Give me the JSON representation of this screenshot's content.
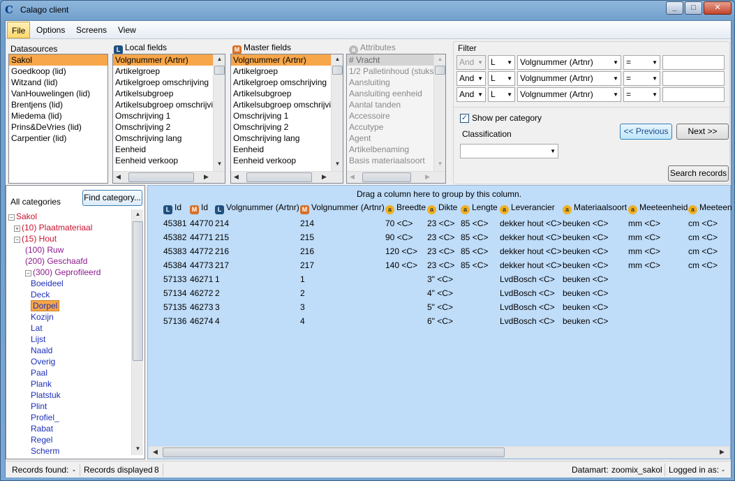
{
  "window": {
    "title": "Calago client"
  },
  "menu": [
    "File",
    "Options",
    "Screens",
    "View"
  ],
  "datasources": {
    "label": "Datasources",
    "items": [
      "Sakol",
      "Goedkoop (lid)",
      "Witzand (lid)",
      "VanHouwelingen (lid)",
      "Brentjens (lid)",
      "Miedema (lid)",
      "Prins&DeVries (lid)",
      "Carpentier (lid)"
    ]
  },
  "local_fields": {
    "badge": "L",
    "label": "Local fields",
    "items": [
      "Volgnummer (Artnr)",
      "Artikelgroep",
      "Artikelgroep omschrijving",
      "Artikelsubgroep",
      "Artikelsubgroep omschrijvin",
      "Omschrijving 1",
      "Omschrijving 2",
      "Omschrijving lang",
      "Eenheid",
      "Eenheid verkoop"
    ]
  },
  "master_fields": {
    "badge": "M",
    "label": "Master fields",
    "items": [
      "Volgnummer (Artnr)",
      "Artikelgroep",
      "Artikelgroep omschrijving",
      "Artikelsubgroep",
      "Artikelsubgroep omschrijvin",
      "Omschrijving 1",
      "Omschrijving 2",
      "Omschrijving lang",
      "Eenheid",
      "Eenheid verkoop"
    ]
  },
  "attributes": {
    "badge": "a",
    "label": "Attributes",
    "items": [
      "# Vracht",
      "1/2 Palletinhoud (stuks)",
      "Aansluiting",
      "Aansluiting eenheid",
      "Aantal tanden",
      "Accessoire",
      "Accutype",
      "Agent",
      "Artikelbenaming",
      "Basis materiaalsoort"
    ]
  },
  "filter": {
    "label": "Filter",
    "rows": [
      {
        "logic": "And",
        "disabled": true,
        "type": "L",
        "field": "Volgnummer (Artnr)",
        "op": "="
      },
      {
        "logic": "And",
        "disabled": false,
        "type": "L",
        "field": "Volgnummer (Artnr)",
        "op": "="
      },
      {
        "logic": "And",
        "disabled": false,
        "type": "L",
        "field": "Volgnummer (Artnr)",
        "op": "="
      }
    ],
    "show_per_category": "Show per category",
    "show_per_category_checked": "✓",
    "classification_label": "Classification",
    "prev_label": "<< Previous",
    "next_label": "Next >>",
    "search_label": "Search records"
  },
  "categories": {
    "title": "All categories",
    "find_label": "Find category...",
    "tree": [
      {
        "text": "Sakol",
        "pm": "−",
        "color": "#c8102e"
      },
      {
        "text": "(10) Plaatmateriaal",
        "pm": "+",
        "color": "#c8102e"
      },
      {
        "text": "(15) Hout",
        "pm": "−",
        "color": "#c8102e"
      },
      {
        "text": "(100) Ruw",
        "pm": "",
        "color": "#8e1a8e"
      },
      {
        "text": "(200) Geschaafd",
        "pm": "",
        "color": "#8e1a8e"
      },
      {
        "text": "(300) Geprofileerd",
        "pm": "−",
        "color": "#8e1a8e"
      },
      {
        "text": "Boeideel",
        "pm": "",
        "color": "#1c2fb8"
      },
      {
        "text": "Deck",
        "pm": "",
        "color": "#1c2fb8"
      },
      {
        "text": "Dorpel",
        "pm": "",
        "color": "#1c2fb8",
        "selected": true
      },
      {
        "text": "Kozijn",
        "pm": "",
        "color": "#1c2fb8"
      },
      {
        "text": "Lat",
        "pm": "",
        "color": "#1c2fb8"
      },
      {
        "text": "Lijst",
        "pm": "",
        "color": "#1c2fb8"
      },
      {
        "text": "Naald",
        "pm": "",
        "color": "#1c2fb8"
      },
      {
        "text": "Overig",
        "pm": "",
        "color": "#1c2fb8"
      },
      {
        "text": "Paal",
        "pm": "",
        "color": "#1c2fb8"
      },
      {
        "text": "Plank",
        "pm": "",
        "color": "#1c2fb8"
      },
      {
        "text": "Platstuk",
        "pm": "",
        "color": "#1c2fb8"
      },
      {
        "text": "Plint",
        "pm": "",
        "color": "#1c2fb8"
      },
      {
        "text": "Profiel_",
        "pm": "",
        "color": "#1c2fb8"
      },
      {
        "text": "Rabat",
        "pm": "",
        "color": "#1c2fb8"
      },
      {
        "text": "Regel",
        "pm": "",
        "color": "#1c2fb8"
      },
      {
        "text": "Scherm",
        "pm": "",
        "color": "#1c2fb8"
      }
    ]
  },
  "grid": {
    "group_hint": "Drag a column here to group by this column.",
    "columns": [
      {
        "badge": "L",
        "label": "Id"
      },
      {
        "badge": "M",
        "label": "Id"
      },
      {
        "badge": "L",
        "label": "Volgnummer (Artnr)"
      },
      {
        "badge": "M",
        "label": "Volgnummer (Artnr)"
      },
      {
        "badge": "a",
        "label": "Breedte"
      },
      {
        "badge": "a",
        "label": "Dikte"
      },
      {
        "badge": "a",
        "label": "Lengte"
      },
      {
        "badge": "a",
        "label": "Leverancier"
      },
      {
        "badge": "a",
        "label": "Materiaalsoort"
      },
      {
        "badge": "a",
        "label": "Meeteenheid"
      },
      {
        "badge": "a",
        "label": "Meeteen"
      }
    ],
    "rows": [
      [
        "45381",
        "44770",
        "214",
        "214",
        "70 <C>",
        "23 <C>",
        "85 <C>",
        "dekker hout <C>",
        "beuken <C>",
        "mm <C>",
        "cm <C>"
      ],
      [
        "45382",
        "44771",
        "215",
        "215",
        "90 <C>",
        "23 <C>",
        "85 <C>",
        "dekker hout <C>",
        "beuken <C>",
        "mm <C>",
        "cm <C>"
      ],
      [
        "45383",
        "44772",
        "216",
        "216",
        "120 <C>",
        "23 <C>",
        "85 <C>",
        "dekker hout <C>",
        "beuken <C>",
        "mm <C>",
        "cm <C>"
      ],
      [
        "45384",
        "44773",
        "217",
        "217",
        "140 <C>",
        "23 <C>",
        "85 <C>",
        "dekker hout <C>",
        "beuken <C>",
        "mm <C>",
        "cm <C>"
      ],
      [
        "57133",
        "46271",
        "1",
        "1",
        "",
        "3\" <C>",
        "",
        "LvdBosch <C>",
        "beuken <C>",
        "",
        ""
      ],
      [
        "57134",
        "46272",
        "2",
        "2",
        "",
        "4\" <C>",
        "",
        "LvdBosch <C>",
        "beuken <C>",
        "",
        ""
      ],
      [
        "57135",
        "46273",
        "3",
        "3",
        "",
        "5\" <C>",
        "",
        "LvdBosch <C>",
        "beuken <C>",
        "",
        ""
      ],
      [
        "57136",
        "46274",
        "4",
        "4",
        "",
        "6\" <C>",
        "",
        "LvdBosch <C>",
        "beuken <C>",
        "",
        ""
      ]
    ]
  },
  "status": {
    "records_found_label": "Records found:",
    "records_found_value": "-",
    "records_displayed_label": "Records displayed",
    "records_displayed_value": "8",
    "datamart_label": "Datamart:",
    "datamart_value": "zoomix_sakol",
    "logged_in_label": "Logged in as:",
    "logged_in_value": "-"
  }
}
